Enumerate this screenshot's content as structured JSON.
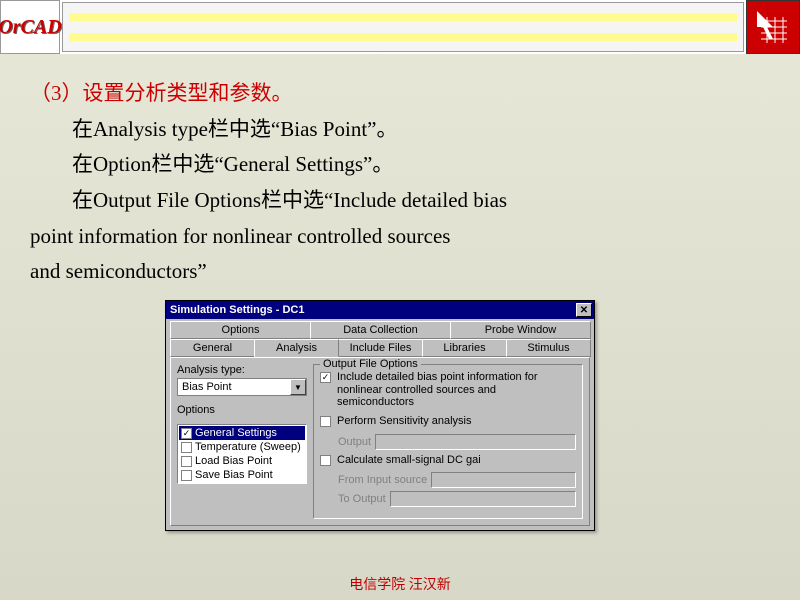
{
  "logo": "OrCAD",
  "heading": "（3）设置分析类型和参数。",
  "p1": "在Analysis type栏中选“Bias Point”。",
  "p2": "在Option栏中选“General Settings”。",
  "p3a": "在Output File Options栏中选“Include detailed bias",
  "p3b": "point information for nonlinear controlled sources",
  "p3c": "and semiconductors”",
  "dialog": {
    "title": "Simulation Settings - DC1",
    "tabs_top": [
      "Options",
      "Data Collection",
      "Probe Window"
    ],
    "tabs_bottom": [
      "General",
      "Analysis",
      "Include Files",
      "Libraries",
      "Stimulus"
    ],
    "active_tab": "Analysis",
    "analysis_type_label": "Analysis type:",
    "analysis_type_value": "Bias Point",
    "options_label": "Options",
    "options_items": [
      {
        "label": "General Settings",
        "checked": true,
        "selected": true
      },
      {
        "label": "Temperature (Sweep)",
        "checked": false,
        "selected": false
      },
      {
        "label": "Load Bias Point",
        "checked": false,
        "selected": false
      },
      {
        "label": "Save Bias Point",
        "checked": false,
        "selected": false
      }
    ],
    "ofo_title": "Output File Options",
    "ofo_check1": "Include detailed bias point information for nonlinear controlled sources and semiconductors",
    "ofo_check1_checked": true,
    "ofo_check2": "Perform Sensitivity analysis",
    "ofo_check2_checked": false,
    "ofo_output_label": "Output",
    "ofo_check3": "Calculate small-signal DC gai",
    "ofo_check3_checked": false,
    "ofo_from_label": "From Input source",
    "ofo_to_label": "To Output"
  },
  "footer": "电信学院 汪汉新"
}
